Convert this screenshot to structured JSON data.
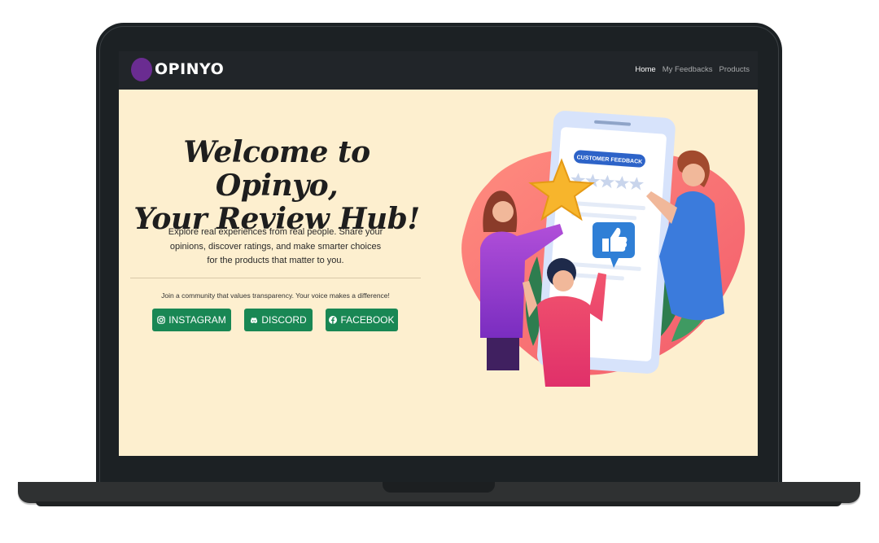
{
  "navbar": {
    "brand": "OPINYO",
    "links": [
      {
        "label": "Home",
        "active": true
      },
      {
        "label": "My Feedbacks",
        "active": false
      },
      {
        "label": "Products",
        "active": false
      }
    ]
  },
  "hero": {
    "title_line1": "Welcome to Opinyo,",
    "title_line2": "Your Review Hub!",
    "description_line1": "Explore real experiences from real people. Share your",
    "description_line2": "opinions, discover ratings, and make smarter choices",
    "description_line3": "for the products that matter to you.",
    "community_text": "Join a community that values transparency. Your voice makes a difference!",
    "buttons": [
      {
        "label": "INSTAGRAM",
        "icon": "instagram-icon"
      },
      {
        "label": "DISCORD",
        "icon": "discord-icon"
      },
      {
        "label": "FACEBOOK",
        "icon": "facebook-icon"
      }
    ]
  },
  "illustration": {
    "badge_text": "CUSTOMER FEEDBACK"
  },
  "colors": {
    "nav_bg": "#212529",
    "page_bg": "#fdefcf",
    "button_green": "#198754",
    "logo_purple": "#6a2c91"
  }
}
